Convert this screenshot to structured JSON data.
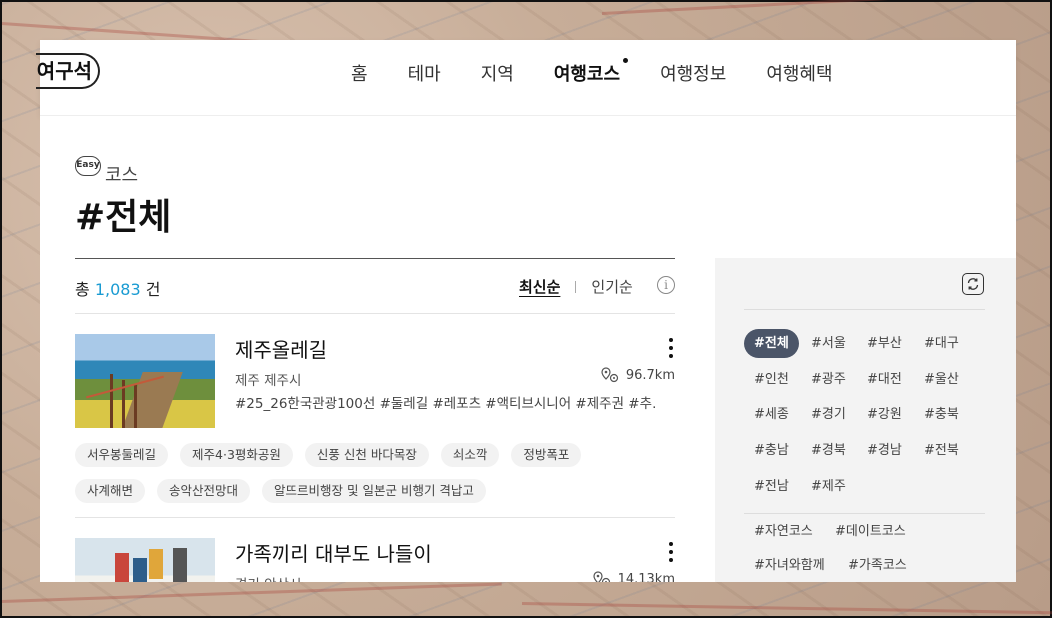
{
  "header": {
    "logo_text": "여구석",
    "nav": [
      "홈",
      "테마",
      "지역",
      "여행코스",
      "여행정보",
      "여행혜택"
    ],
    "active_nav": "여행코스"
  },
  "page": {
    "badge": "Easy",
    "category": "코스",
    "title": "#전체"
  },
  "list": {
    "count_prefix": "총",
    "count": "1,083",
    "count_suffix": "건",
    "sort_latest": "최신순",
    "sort_popular": "인기순",
    "info": "i"
  },
  "cards": [
    {
      "title": "제주올레길",
      "region": "제주 제주시",
      "distance": "96.7km",
      "tags": "#25_26한국관광100선 #둘레길 #레포츠 #액티브시니어 #제주권 #추…",
      "chips": [
        "서우봉둘레길",
        "제주4·3평화공원",
        "신풍 신천 바다목장",
        "쇠소깍",
        "정방폭포",
        "사계해변",
        "송악산전망대",
        "알뜨르비행장 및 일본군 비행기 격납고"
      ]
    },
    {
      "title": "가족끼리 대부도 나들이",
      "region": "경기 안산시",
      "distance": "14.13km"
    }
  ],
  "sidebar": {
    "region_tags": [
      "#전체",
      "#서울",
      "#부산",
      "#대구",
      "#인천",
      "#광주",
      "#대전",
      "#울산",
      "#세종",
      "#경기",
      "#강원",
      "#충북",
      "#충남",
      "#경북",
      "#경남",
      "#전북",
      "#전남",
      "#제주"
    ],
    "active_region": "#전체",
    "theme_tags": [
      "#자연코스",
      "#데이트코스",
      "#자녀와함께",
      "#가족코스"
    ]
  },
  "colors": {
    "accent": "#1a9bd2",
    "active_chip": "#4b5568",
    "sidebar_bg": "#f3f3f3"
  }
}
